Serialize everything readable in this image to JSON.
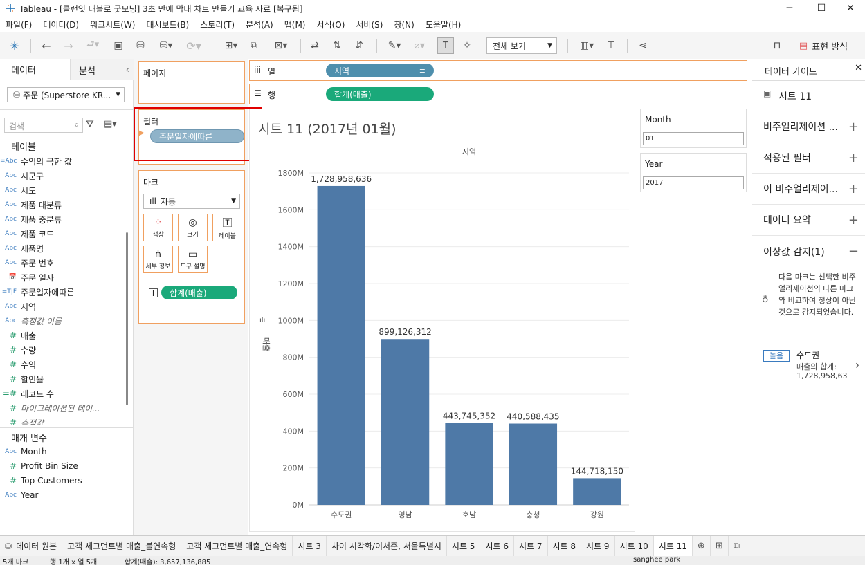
{
  "window": {
    "title": "Tableau - [클랜잇 태블로 굿모닝] 3초 만에 막대 차트 만들기 교육 자료 [복구됨]"
  },
  "menu": [
    "파일(F)",
    "데이터(D)",
    "워크시트(W)",
    "대시보드(B)",
    "스토리(T)",
    "분석(A)",
    "맵(M)",
    "서식(O)",
    "서버(S)",
    "창(N)",
    "도움말(H)"
  ],
  "toolbar": {
    "view_select": "전체 보기",
    "show_me": "표현 방식"
  },
  "left_pane": {
    "tab_data": "데이터",
    "tab_analysis": "분석",
    "datasource": "주문 (Superstore KR...",
    "search_placeholder": "검색",
    "tables_header": "테이블",
    "fields": [
      {
        "icon": "=Abc",
        "name": "수익의 극한 값"
      },
      {
        "icon": "Abc",
        "name": "시군구"
      },
      {
        "icon": "Abc",
        "name": "시도"
      },
      {
        "icon": "Abc",
        "name": "제품 대분류"
      },
      {
        "icon": "Abc",
        "name": "제품 중분류"
      },
      {
        "icon": "Abc",
        "name": "제품 코드"
      },
      {
        "icon": "Abc",
        "name": "제품명"
      },
      {
        "icon": "Abc",
        "name": "주문 번호"
      },
      {
        "icon": "📅",
        "name": "주문 일자"
      },
      {
        "icon": "=T|F",
        "name": "주문일자에따른"
      },
      {
        "icon": "Abc",
        "name": "지역"
      },
      {
        "icon": "Abc",
        "name": "측정값 이름"
      },
      {
        "icon": "#",
        "name": "매출"
      },
      {
        "icon": "#",
        "name": "수량"
      },
      {
        "icon": "#",
        "name": "수익"
      },
      {
        "icon": "#",
        "name": "할인율"
      },
      {
        "icon": "=#",
        "name": "레코드 수"
      },
      {
        "icon": "#",
        "name": "마이그레이션된 데이..."
      },
      {
        "icon": "#",
        "name": "측정값"
      }
    ],
    "params_header": "매개 변수",
    "params": [
      {
        "icon": "Abc",
        "name": "Month"
      },
      {
        "icon": "#",
        "name": "Profit Bin Size"
      },
      {
        "icon": "#",
        "name": "Top Customers"
      },
      {
        "icon": "Abc",
        "name": "Year"
      }
    ]
  },
  "shelves": {
    "pages_label": "페이지",
    "filters_label": "필터",
    "filter_pill": "주문일자에따른",
    "marks_label": "마크",
    "mark_type": "자동",
    "mark_buttons": [
      "색상",
      "크기",
      "레이블",
      "세부 정보",
      "도구 설명"
    ],
    "mark_label_pill": "합계(매출)",
    "columns_label": "열",
    "columns_pill": "지역",
    "rows_label": "행",
    "rows_pill": "합계(매출)"
  },
  "sheet_title": "시트 11 (2017년 01월)",
  "chart_data": {
    "type": "bar",
    "xlabel": "지역",
    "ylabel": "매출",
    "categories": [
      "수도권",
      "영남",
      "호남",
      "충청",
      "강원"
    ],
    "values": [
      1728958636,
      899126312,
      443745352,
      440588435,
      144718150
    ],
    "data_labels": [
      "1,728,958,636",
      "899,126,312",
      "443,745,352",
      "440,588,435",
      "144,718,150"
    ],
    "ylim": [
      0,
      1800000000
    ],
    "yticks": [
      "0M",
      "200M",
      "400M",
      "600M",
      "800M",
      "1000M",
      "1200M",
      "1400M",
      "1600M",
      "1800M"
    ],
    "bar_color": "#4e79a7",
    "grid": true
  },
  "param_cards": [
    {
      "label": "Month",
      "value": "01"
    },
    {
      "label": "Year",
      "value": "2017"
    }
  ],
  "guide": {
    "header": "데이터 가이드",
    "sheet": "시트 11",
    "sections": [
      "비주얼리제이션 ...",
      "적용된 필터",
      "이 비주얼리제이...",
      "데이터 요약",
      "이상값 감지(1)"
    ],
    "outlier_text": "다음 마크는 선택한 비주얼리제이션의 다른 마크와 비교하여 정상이 아닌 것으로 감지되었습니다.",
    "badge": "높음",
    "item_title": "수도권",
    "item_line1": "매출의 합계:",
    "item_line2": "1,728,958,63"
  },
  "tabs": [
    "데이터 원본",
    "고객 세그먼트별 매출_불연속형",
    "고객 세그먼트별 매출_연속형",
    "시트 3",
    "차이 시각화/이서준, 서울특별시",
    "시트 5",
    "시트 6",
    "시트 7",
    "시트 8",
    "시트 9",
    "시트 10",
    "시트 11"
  ],
  "status": {
    "marks": "5개 마크",
    "rows_cols": "행 1개 x 열 5개",
    "sum": "합계(매출): 3,657,136,885",
    "user": "sanghee park"
  }
}
